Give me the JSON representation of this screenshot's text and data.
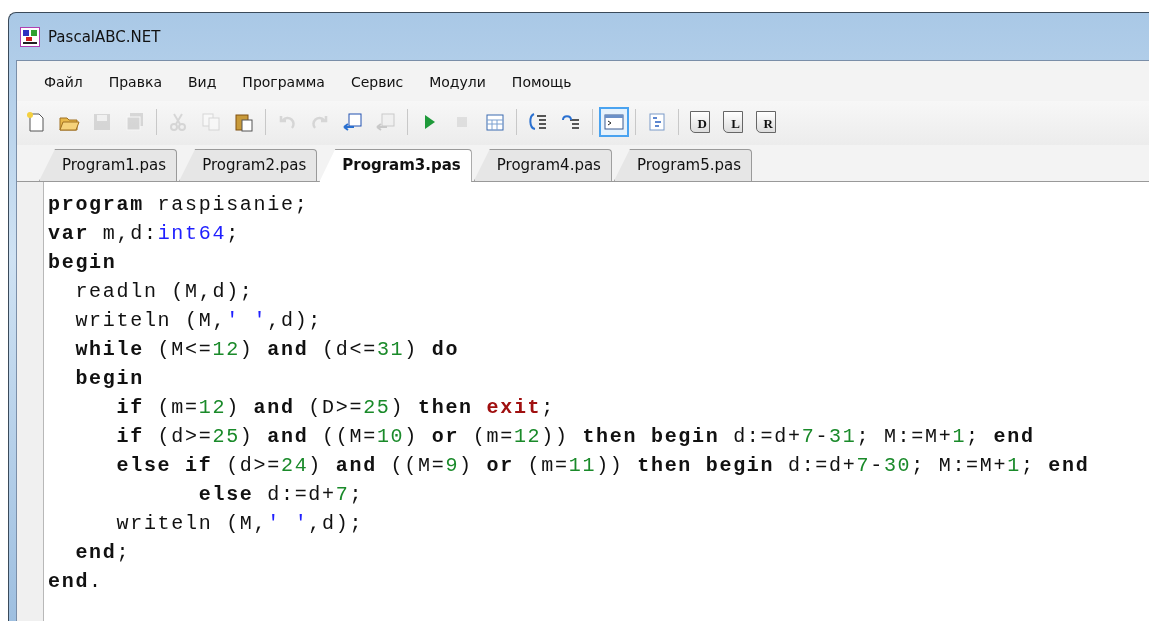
{
  "window": {
    "title": "PascalABC.NET"
  },
  "menu": [
    "Файл",
    "Правка",
    "Вид",
    "Программа",
    "Сервис",
    "Модули",
    "Помощь"
  ],
  "toolbar": [
    {
      "kind": "new",
      "disabled": false,
      "pressed": false
    },
    {
      "kind": "open",
      "disabled": false,
      "pressed": false
    },
    {
      "kind": "save",
      "disabled": true,
      "pressed": false
    },
    {
      "kind": "save-all",
      "disabled": true,
      "pressed": false
    },
    {
      "kind": "separator"
    },
    {
      "kind": "cut",
      "disabled": true,
      "pressed": false
    },
    {
      "kind": "copy",
      "disabled": true,
      "pressed": false
    },
    {
      "kind": "paste",
      "disabled": false,
      "pressed": false
    },
    {
      "kind": "separator"
    },
    {
      "kind": "undo",
      "disabled": true,
      "pressed": false
    },
    {
      "kind": "redo",
      "disabled": true,
      "pressed": false
    },
    {
      "kind": "doc-arrow",
      "disabled": false,
      "pressed": false
    },
    {
      "kind": "doc-arrow",
      "disabled": true,
      "pressed": false
    },
    {
      "kind": "separator"
    },
    {
      "kind": "run",
      "disabled": false,
      "pressed": false
    },
    {
      "kind": "stop",
      "disabled": true,
      "pressed": false
    },
    {
      "kind": "grid",
      "disabled": false,
      "pressed": false
    },
    {
      "kind": "separator"
    },
    {
      "kind": "step-into",
      "disabled": false,
      "pressed": false
    },
    {
      "kind": "step-over",
      "disabled": false,
      "pressed": false
    },
    {
      "kind": "separator"
    },
    {
      "kind": "console",
      "disabled": false,
      "pressed": true
    },
    {
      "kind": "separator"
    },
    {
      "kind": "outline",
      "disabled": false,
      "pressed": false
    },
    {
      "kind": "separator"
    },
    {
      "kind": "letter-page",
      "label": "D",
      "disabled": false,
      "pressed": false
    },
    {
      "kind": "letter-page",
      "label": "L",
      "disabled": false,
      "pressed": false
    },
    {
      "kind": "letter-page",
      "label": "R",
      "disabled": false,
      "pressed": false
    }
  ],
  "tabs": [
    {
      "label": "Program1.pas",
      "selected": false
    },
    {
      "label": "Program2.pas",
      "selected": false
    },
    {
      "label": "Program3.pas",
      "selected": true
    },
    {
      "label": "Program4.pas",
      "selected": false
    },
    {
      "label": "Program5.pas",
      "selected": false
    }
  ],
  "editor": {
    "lines": [
      [
        {
          "kind": "keyword",
          "text": "program"
        },
        {
          "kind": "plain",
          "text": " raspisanie;"
        }
      ],
      [
        {
          "kind": "keyword",
          "text": "var"
        },
        {
          "kind": "plain",
          "text": " m,d:"
        },
        {
          "kind": "type",
          "text": "int64"
        },
        {
          "kind": "plain",
          "text": ";"
        }
      ],
      [
        {
          "kind": "keyword",
          "text": "begin"
        }
      ],
      [
        {
          "kind": "plain",
          "text": "  readln (M,d);"
        }
      ],
      [
        {
          "kind": "plain",
          "text": "  writeln (M,"
        },
        {
          "kind": "string",
          "text": "' '"
        },
        {
          "kind": "plain",
          "text": ",d);"
        }
      ],
      [
        {
          "kind": "keyword",
          "text": "  while"
        },
        {
          "kind": "plain",
          "text": " (M<="
        },
        {
          "kind": "number",
          "text": "12"
        },
        {
          "kind": "plain",
          "text": ") "
        },
        {
          "kind": "keyword",
          "text": "and"
        },
        {
          "kind": "plain",
          "text": " (d<="
        },
        {
          "kind": "number",
          "text": "31"
        },
        {
          "kind": "plain",
          "text": ") "
        },
        {
          "kind": "keyword",
          "text": "do"
        }
      ],
      [
        {
          "kind": "keyword",
          "text": "  begin"
        }
      ],
      [
        {
          "kind": "keyword",
          "text": "     if"
        },
        {
          "kind": "plain",
          "text": " (m="
        },
        {
          "kind": "number",
          "text": "12"
        },
        {
          "kind": "plain",
          "text": ") "
        },
        {
          "kind": "keyword",
          "text": "and"
        },
        {
          "kind": "plain",
          "text": " (D>="
        },
        {
          "kind": "number",
          "text": "25"
        },
        {
          "kind": "plain",
          "text": ") "
        },
        {
          "kind": "keyword",
          "text": "then "
        },
        {
          "kind": "exit",
          "text": "exit"
        },
        {
          "kind": "plain",
          "text": ";"
        }
      ],
      [
        {
          "kind": "keyword",
          "text": "     if"
        },
        {
          "kind": "plain",
          "text": " (d>="
        },
        {
          "kind": "number",
          "text": "25"
        },
        {
          "kind": "plain",
          "text": ") "
        },
        {
          "kind": "keyword",
          "text": "and"
        },
        {
          "kind": "plain",
          "text": " ((M="
        },
        {
          "kind": "number",
          "text": "10"
        },
        {
          "kind": "plain",
          "text": ") "
        },
        {
          "kind": "keyword",
          "text": "or"
        },
        {
          "kind": "plain",
          "text": " (m="
        },
        {
          "kind": "number",
          "text": "12"
        },
        {
          "kind": "plain",
          "text": ")) "
        },
        {
          "kind": "keyword",
          "text": "then begin"
        },
        {
          "kind": "plain",
          "text": " d:=d+"
        },
        {
          "kind": "number",
          "text": "7"
        },
        {
          "kind": "plain",
          "text": "-"
        },
        {
          "kind": "number",
          "text": "31"
        },
        {
          "kind": "plain",
          "text": "; M:=M+"
        },
        {
          "kind": "number",
          "text": "1"
        },
        {
          "kind": "plain",
          "text": "; "
        },
        {
          "kind": "keyword",
          "text": "end"
        }
      ],
      [
        {
          "kind": "keyword",
          "text": "     else if"
        },
        {
          "kind": "plain",
          "text": " (d>="
        },
        {
          "kind": "number",
          "text": "24"
        },
        {
          "kind": "plain",
          "text": ") "
        },
        {
          "kind": "keyword",
          "text": "and"
        },
        {
          "kind": "plain",
          "text": " ((M="
        },
        {
          "kind": "number",
          "text": "9"
        },
        {
          "kind": "plain",
          "text": ") "
        },
        {
          "kind": "keyword",
          "text": "or"
        },
        {
          "kind": "plain",
          "text": " (m="
        },
        {
          "kind": "number",
          "text": "11"
        },
        {
          "kind": "plain",
          "text": ")) "
        },
        {
          "kind": "keyword",
          "text": "then begin"
        },
        {
          "kind": "plain",
          "text": " d:=d+"
        },
        {
          "kind": "number",
          "text": "7"
        },
        {
          "kind": "plain",
          "text": "-"
        },
        {
          "kind": "number",
          "text": "30"
        },
        {
          "kind": "plain",
          "text": "; M:=M+"
        },
        {
          "kind": "number",
          "text": "1"
        },
        {
          "kind": "plain",
          "text": "; "
        },
        {
          "kind": "keyword",
          "text": "end"
        }
      ],
      [
        {
          "kind": "keyword",
          "text": "           else"
        },
        {
          "kind": "plain",
          "text": " d:=d+"
        },
        {
          "kind": "number",
          "text": "7"
        },
        {
          "kind": "plain",
          "text": ";"
        }
      ],
      [
        {
          "kind": "plain",
          "text": "     writeln (M,"
        },
        {
          "kind": "string",
          "text": "' '"
        },
        {
          "kind": "plain",
          "text": ",d);"
        }
      ],
      [
        {
          "kind": "keyword",
          "text": "  end"
        },
        {
          "kind": "plain",
          "text": ";"
        }
      ],
      [
        {
          "kind": "keyword",
          "text": "end"
        },
        {
          "kind": "plain",
          "text": "."
        }
      ]
    ]
  }
}
